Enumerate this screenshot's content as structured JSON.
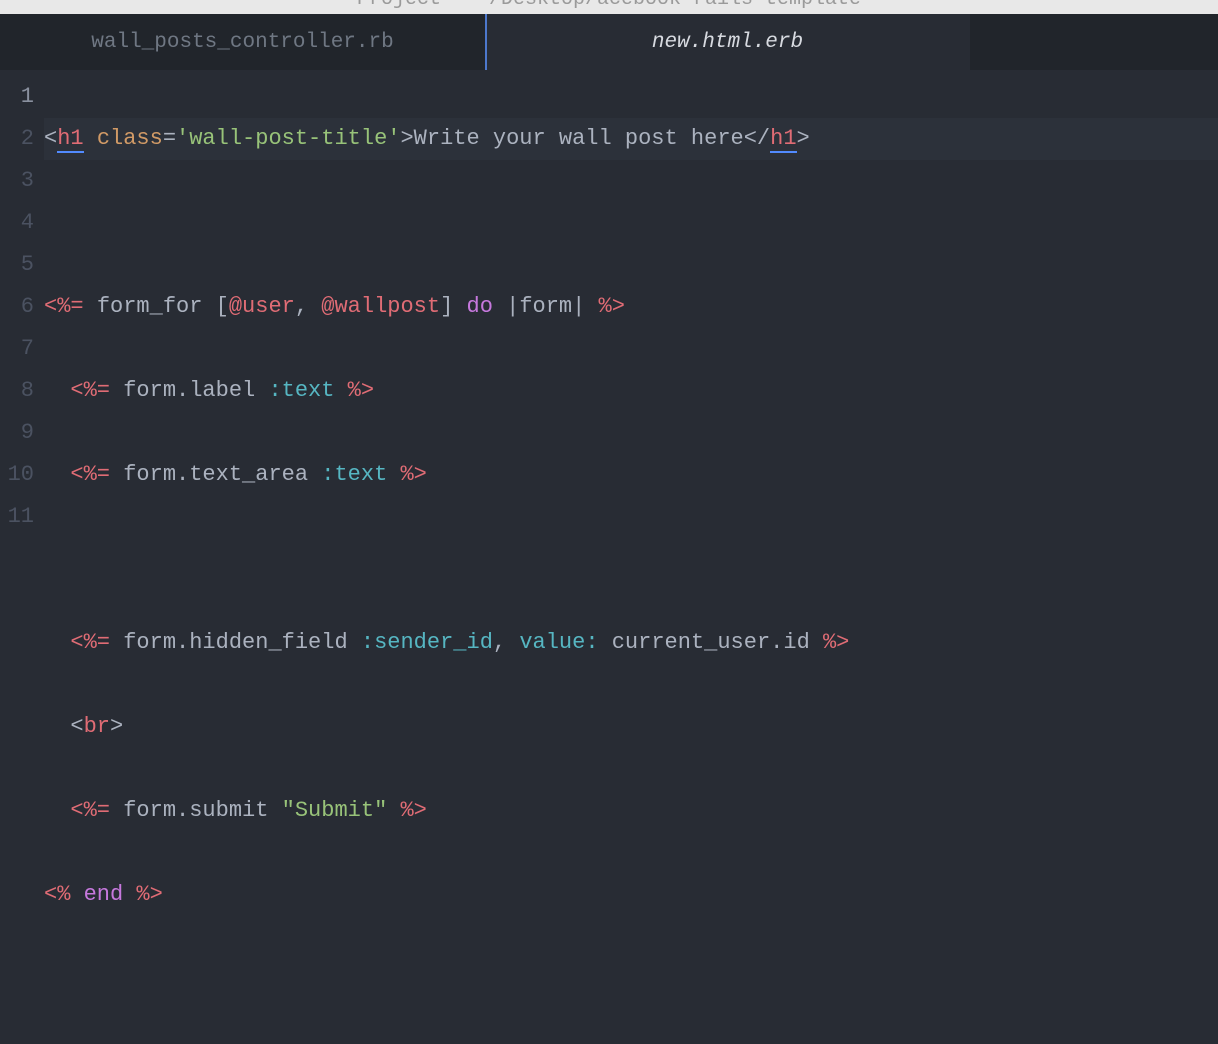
{
  "titlebar": {
    "text": "Project — ~/Desktop/acebook-rails-template"
  },
  "tabs": {
    "left": {
      "label": "wall_posts_controller.rb",
      "active": false
    },
    "right": {
      "label": "new.html.erb",
      "active": true
    }
  },
  "gutter": {
    "l1": "1",
    "l2": "2",
    "l3": "3",
    "l4": "4",
    "l5": "5",
    "l6": "6",
    "l7": "7",
    "l8": "8",
    "l9": "9",
    "l10": "10",
    "l11": "11"
  },
  "code": {
    "l1": {
      "lt": "<",
      "tag_open": "h1",
      "sp": " ",
      "attr": "class",
      "eq": "=",
      "str": "'wall-post-title'",
      "gt": ">",
      "text": "Write your wall post here",
      "lts": "</",
      "tag_close": "h1",
      "gt2": ">"
    },
    "l3": {
      "open": "<%=",
      "sp": " ",
      "fn": "form_for ",
      "lbr": "[",
      "ivar1": "@user",
      "comma": ", ",
      "ivar2": "@wallpost",
      "rbr": "]",
      "sp2": " ",
      "do": "do",
      "sp3": " ",
      "p1": "|",
      "arg": "form",
      "p2": "|",
      "sp4": " ",
      "close": "%>"
    },
    "l4": {
      "open": "<%=",
      "sp": " ",
      "recv": "form",
      "dot": ".",
      "meth": "label ",
      "sym": ":text",
      "sp2": " ",
      "close": "%>"
    },
    "l5": {
      "open": "<%=",
      "sp": " ",
      "recv": "form",
      "dot": ".",
      "meth": "text_area ",
      "sym": ":text",
      "sp2": " ",
      "close": "%>"
    },
    "l7": {
      "open": "<%=",
      "sp": " ",
      "recv": "form",
      "dot": ".",
      "meth": "hidden_field ",
      "sym": ":sender_id",
      "comma": ", ",
      "key": "value:",
      "sp2": " ",
      "val": "current_user",
      "dot2": ".",
      "prop": "id",
      "sp3": " ",
      "close": "%>"
    },
    "l8": {
      "lt": "<",
      "tag": "br",
      "gt": ">"
    },
    "l9": {
      "open": "<%=",
      "sp": " ",
      "recv": "form",
      "dot": ".",
      "meth": "submit ",
      "str": "\"Submit\"",
      "sp2": " ",
      "close": "%>"
    },
    "l10": {
      "open": "<%",
      "sp": " ",
      "end": "end",
      "sp2": " ",
      "close": "%>"
    }
  }
}
